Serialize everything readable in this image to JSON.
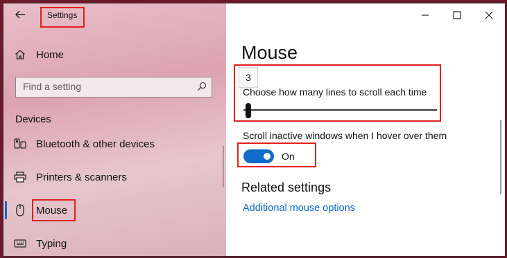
{
  "titlebar": {
    "title": "Settings",
    "back_icon": "back-arrow-icon",
    "controls": [
      "minimize-icon",
      "maximize-icon",
      "close-icon"
    ]
  },
  "sidebar": {
    "home_label": "Home",
    "search_placeholder": "Find a setting",
    "section_label": "Devices",
    "items": [
      {
        "label": "Bluetooth & other devices",
        "icon": "bluetooth-devices-icon"
      },
      {
        "label": "Printers & scanners",
        "icon": "printer-icon"
      },
      {
        "label": "Mouse",
        "icon": "mouse-icon",
        "selected": true
      },
      {
        "label": "Typing",
        "icon": "keyboard-icon"
      }
    ]
  },
  "main": {
    "page_title": "Mouse",
    "scroll_lines": {
      "label": "Choose how many lines to scroll each time",
      "value": "3",
      "min": 1,
      "max": 100
    },
    "inactive_scroll": {
      "label": "Scroll inactive windows when I hover over them",
      "state": "On"
    },
    "related_heading": "Related settings",
    "related_link": "Additional mouse options"
  },
  "colors": {
    "accent": "#0f6cc9",
    "highlight_box": "#e0201c",
    "link": "#0a66c2",
    "sidebar_bg": "#dca3b2"
  }
}
